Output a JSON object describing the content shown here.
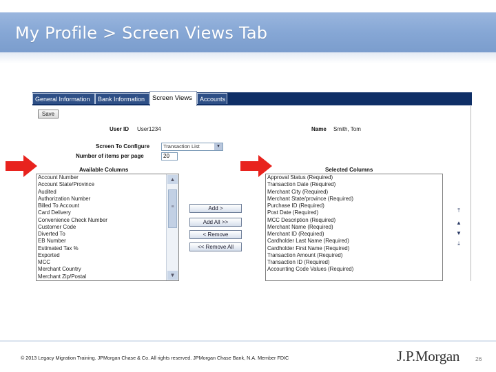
{
  "slide": {
    "title": "My Profile > Screen Views Tab",
    "footer": "© 2013 Legacy Migration Training. JPMorgan Chase & Co. All rights reserved. JPMorgan Chase Bank, N.A. Member FDIC",
    "logo": "J.P.Morgan",
    "page_number": "26"
  },
  "tabs": [
    {
      "label": "General Information",
      "active": false
    },
    {
      "label": "Bank Information",
      "active": false
    },
    {
      "label": "Screen Views",
      "active": true
    },
    {
      "label": "Accounts",
      "active": false
    }
  ],
  "form": {
    "save_label": "Save",
    "user_id_label": "User ID",
    "user_id_value": "User1234",
    "name_label": "Name",
    "name_value": "Smith, Tom",
    "screen_label": "Screen To Configure",
    "screen_value": "Transaction List",
    "items_label": "Number of items per page",
    "items_value": "20"
  },
  "available": {
    "label": "Available Columns",
    "items": [
      "Account Number",
      "Account State/Province",
      "Audited",
      "Authorization Number",
      "Billed To Account",
      "Card Delivery",
      "Convenience Check Number",
      "Customer Code",
      "Diverted To",
      "EB Number",
      "Estimated Tax %",
      "Exported",
      "MCC",
      "Merchant Country",
      "Merchant Zip/Postal"
    ]
  },
  "buttons": {
    "add": "Add >",
    "add_all": "Add All >>",
    "remove": "< Remove",
    "remove_all": "<< Remove All"
  },
  "selected": {
    "label": "Selected Columns",
    "items": [
      "Approval Status (Required)",
      "Transaction Date (Required)",
      "Merchant City (Required)",
      "Merchant State/province (Required)",
      "Purchase ID (Required)",
      "Post Date (Required)",
      "MCC Description (Required)",
      "Merchant Name (Required)",
      "Merchant ID (Required)",
      "Cardholder Last Name (Required)",
      "Cardholder First Name (Required)",
      "Transaction Amount (Required)",
      "Transaction ID (Required)",
      "Accounting Code Values (Required)"
    ]
  },
  "colors": {
    "header_blue": "#86a7d5",
    "tabbar_navy": "#0f2f66",
    "arrow_red": "#e8231e"
  }
}
